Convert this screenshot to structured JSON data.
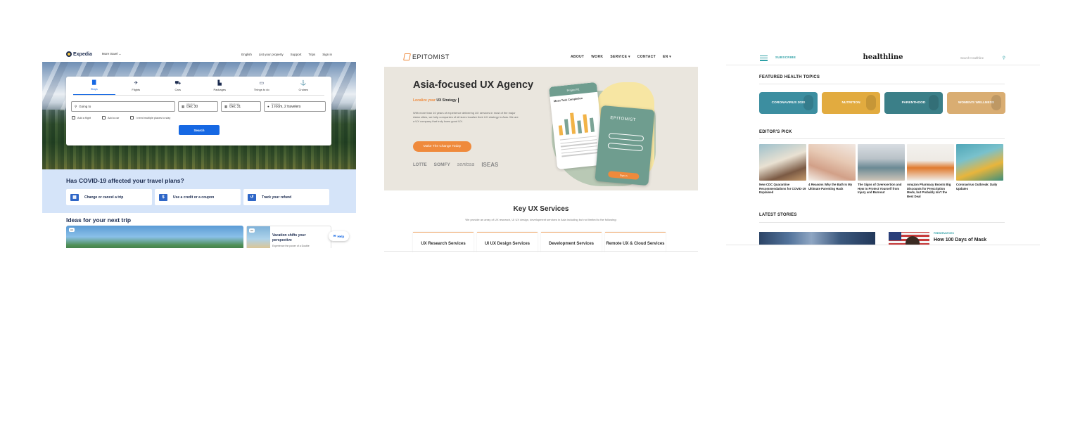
{
  "expedia": {
    "brand": "Expedia",
    "more_travel": "More travel ⌄",
    "nav": [
      "English",
      "List your property",
      "Support",
      "Trips",
      "Sign in"
    ],
    "tabs": [
      {
        "label": "Stays",
        "icon": "building-icon",
        "glyph": "▇",
        "active": true
      },
      {
        "label": "Flights",
        "icon": "plane-icon",
        "glyph": "✈",
        "active": false
      },
      {
        "label": "Cars",
        "icon": "car-icon",
        "glyph": "⛟",
        "active": false
      },
      {
        "label": "Packages",
        "icon": "package-icon",
        "glyph": "▙",
        "active": false
      },
      {
        "label": "Things to do",
        "icon": "ticket-icon",
        "glyph": "▭",
        "active": false
      },
      {
        "label": "Cruises",
        "icon": "ship-icon",
        "glyph": "⚓",
        "active": false
      }
    ],
    "going_to": "Going to",
    "check_in_label": "Check-in",
    "check_in": "Dec 30",
    "check_out_label": "Check-out",
    "check_out": "Dec 31",
    "travelers_label": "Travelers",
    "travelers": "1 room, 2 travelers",
    "checks": [
      "Add a flight",
      "Add a car",
      "I need multiple places to stay"
    ],
    "search_button": "Search",
    "covid_title": "Has COVID-19 affected your travel plans?",
    "covid_cards": [
      "Change or cancel a trip",
      "Use a credit or a coupon",
      "Track your refund"
    ],
    "ideas_title": "Ideas for your next trip",
    "ideas_tag": "Ad",
    "ideas_card_tag": "Ad",
    "ideas_card_title": "Vacation shifts your perspective",
    "ideas_card_sub": "Experience the power of a Double",
    "help": "Help"
  },
  "epitomist": {
    "brand": "EPITOMIST",
    "nav": [
      "ABOUT",
      "WORK",
      "SERVICE ▾",
      "CONTACT",
      "EN ▾"
    ],
    "headline": "Asia-focused UX Agency",
    "sub_prefix": "Localize your",
    "sub_strong": "UX Strategy",
    "paragraph": "With more than 10 years of experience delivering UX services in most of the major Asian cities, we help companies of all sizes localize their UX strategy in Asia. We are a UX company that truly loves good UX.",
    "cta": "Make The Change Today",
    "clients": [
      "LOTTE",
      "SOMFY",
      "sentosa",
      "ISEAS"
    ],
    "phone1_header": "Project #1",
    "phone1_title": "Mean Task Completion",
    "phone2_brand": "EPITOMIST",
    "phone2_button": "Sign In",
    "services_title": "Key UX Services",
    "services_sub": "We provide an array of UX research, UI UX design, development services in Asia including but not limited to the following:",
    "services": [
      "UX Research Services",
      "UI UX Design Services",
      "Development Services",
      "Remote UX & Cloud Services"
    ]
  },
  "healthline": {
    "subscribe": "SUBSCRIBE",
    "logo": "healthline",
    "search_placeholder": "Search Healthline",
    "featured_title": "FEATURED HEALTH TOPICS",
    "topics": [
      {
        "label": "CORONAVIRUS 2020",
        "color": "#3c8ea0"
      },
      {
        "label": "NUTRITION",
        "color": "#e2ab3f"
      },
      {
        "label": "PARENTHOOD",
        "color": "#3b7f88"
      },
      {
        "label": "WOMEN'S WELLNESS",
        "color": "#d9ad72"
      }
    ],
    "editors_title": "EDITOR'S PICK",
    "picks": [
      "New CDC Quarantine Recommendations for COVID-19 Explained",
      "4 Reasons Why the Bath Is My Ultimate Parenting Hack",
      "The Signs of Overexertion and How to Protect Yourself from Injury and Burnout",
      "Amazon Pharmacy Boosts Big Discounts for Prescription Meds, but Probably Isn't the Best Deal",
      "Coronavirus Outbreak: Daily Updates"
    ],
    "latest_title": "LATEST STORIES",
    "latest_tag": "PRESERVATIVES",
    "latest_story": "How 100 Days of Mask"
  }
}
